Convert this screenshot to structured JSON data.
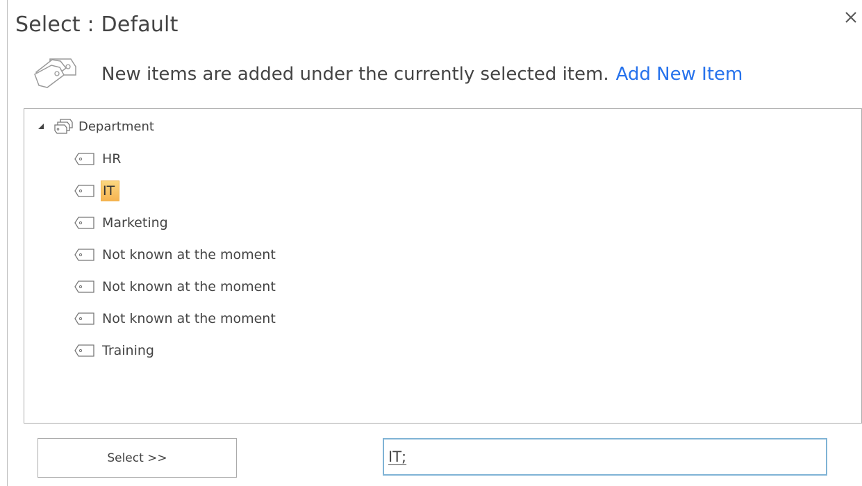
{
  "dialog": {
    "title": "Select : Default",
    "close_icon": "close-icon"
  },
  "intro": {
    "icon": "tags-icon",
    "text": "New items are added under the currently selected item.",
    "link_label": "Add New Item",
    "link_color": "#2672ec"
  },
  "tree": {
    "root": {
      "label": "Department",
      "expanded": true,
      "icon": "term-set-icon"
    },
    "terms": [
      {
        "label": "HR",
        "selected": false,
        "icon": "term-icon"
      },
      {
        "label": "IT",
        "selected": true,
        "icon": "term-icon"
      },
      {
        "label": "Marketing",
        "selected": false,
        "icon": "term-icon"
      },
      {
        "label": "Not known at the moment",
        "selected": false,
        "icon": "term-icon"
      },
      {
        "label": "Not known at the moment",
        "selected": false,
        "icon": "term-icon"
      },
      {
        "label": "Not known at the moment",
        "selected": false,
        "icon": "term-icon"
      },
      {
        "label": "Training",
        "selected": false,
        "icon": "term-icon"
      }
    ],
    "selection_color": "#f6b452"
  },
  "footer": {
    "select_button_label": "Select >>",
    "selected_value": "IT;",
    "field_border_color": "#7fb3d5"
  }
}
